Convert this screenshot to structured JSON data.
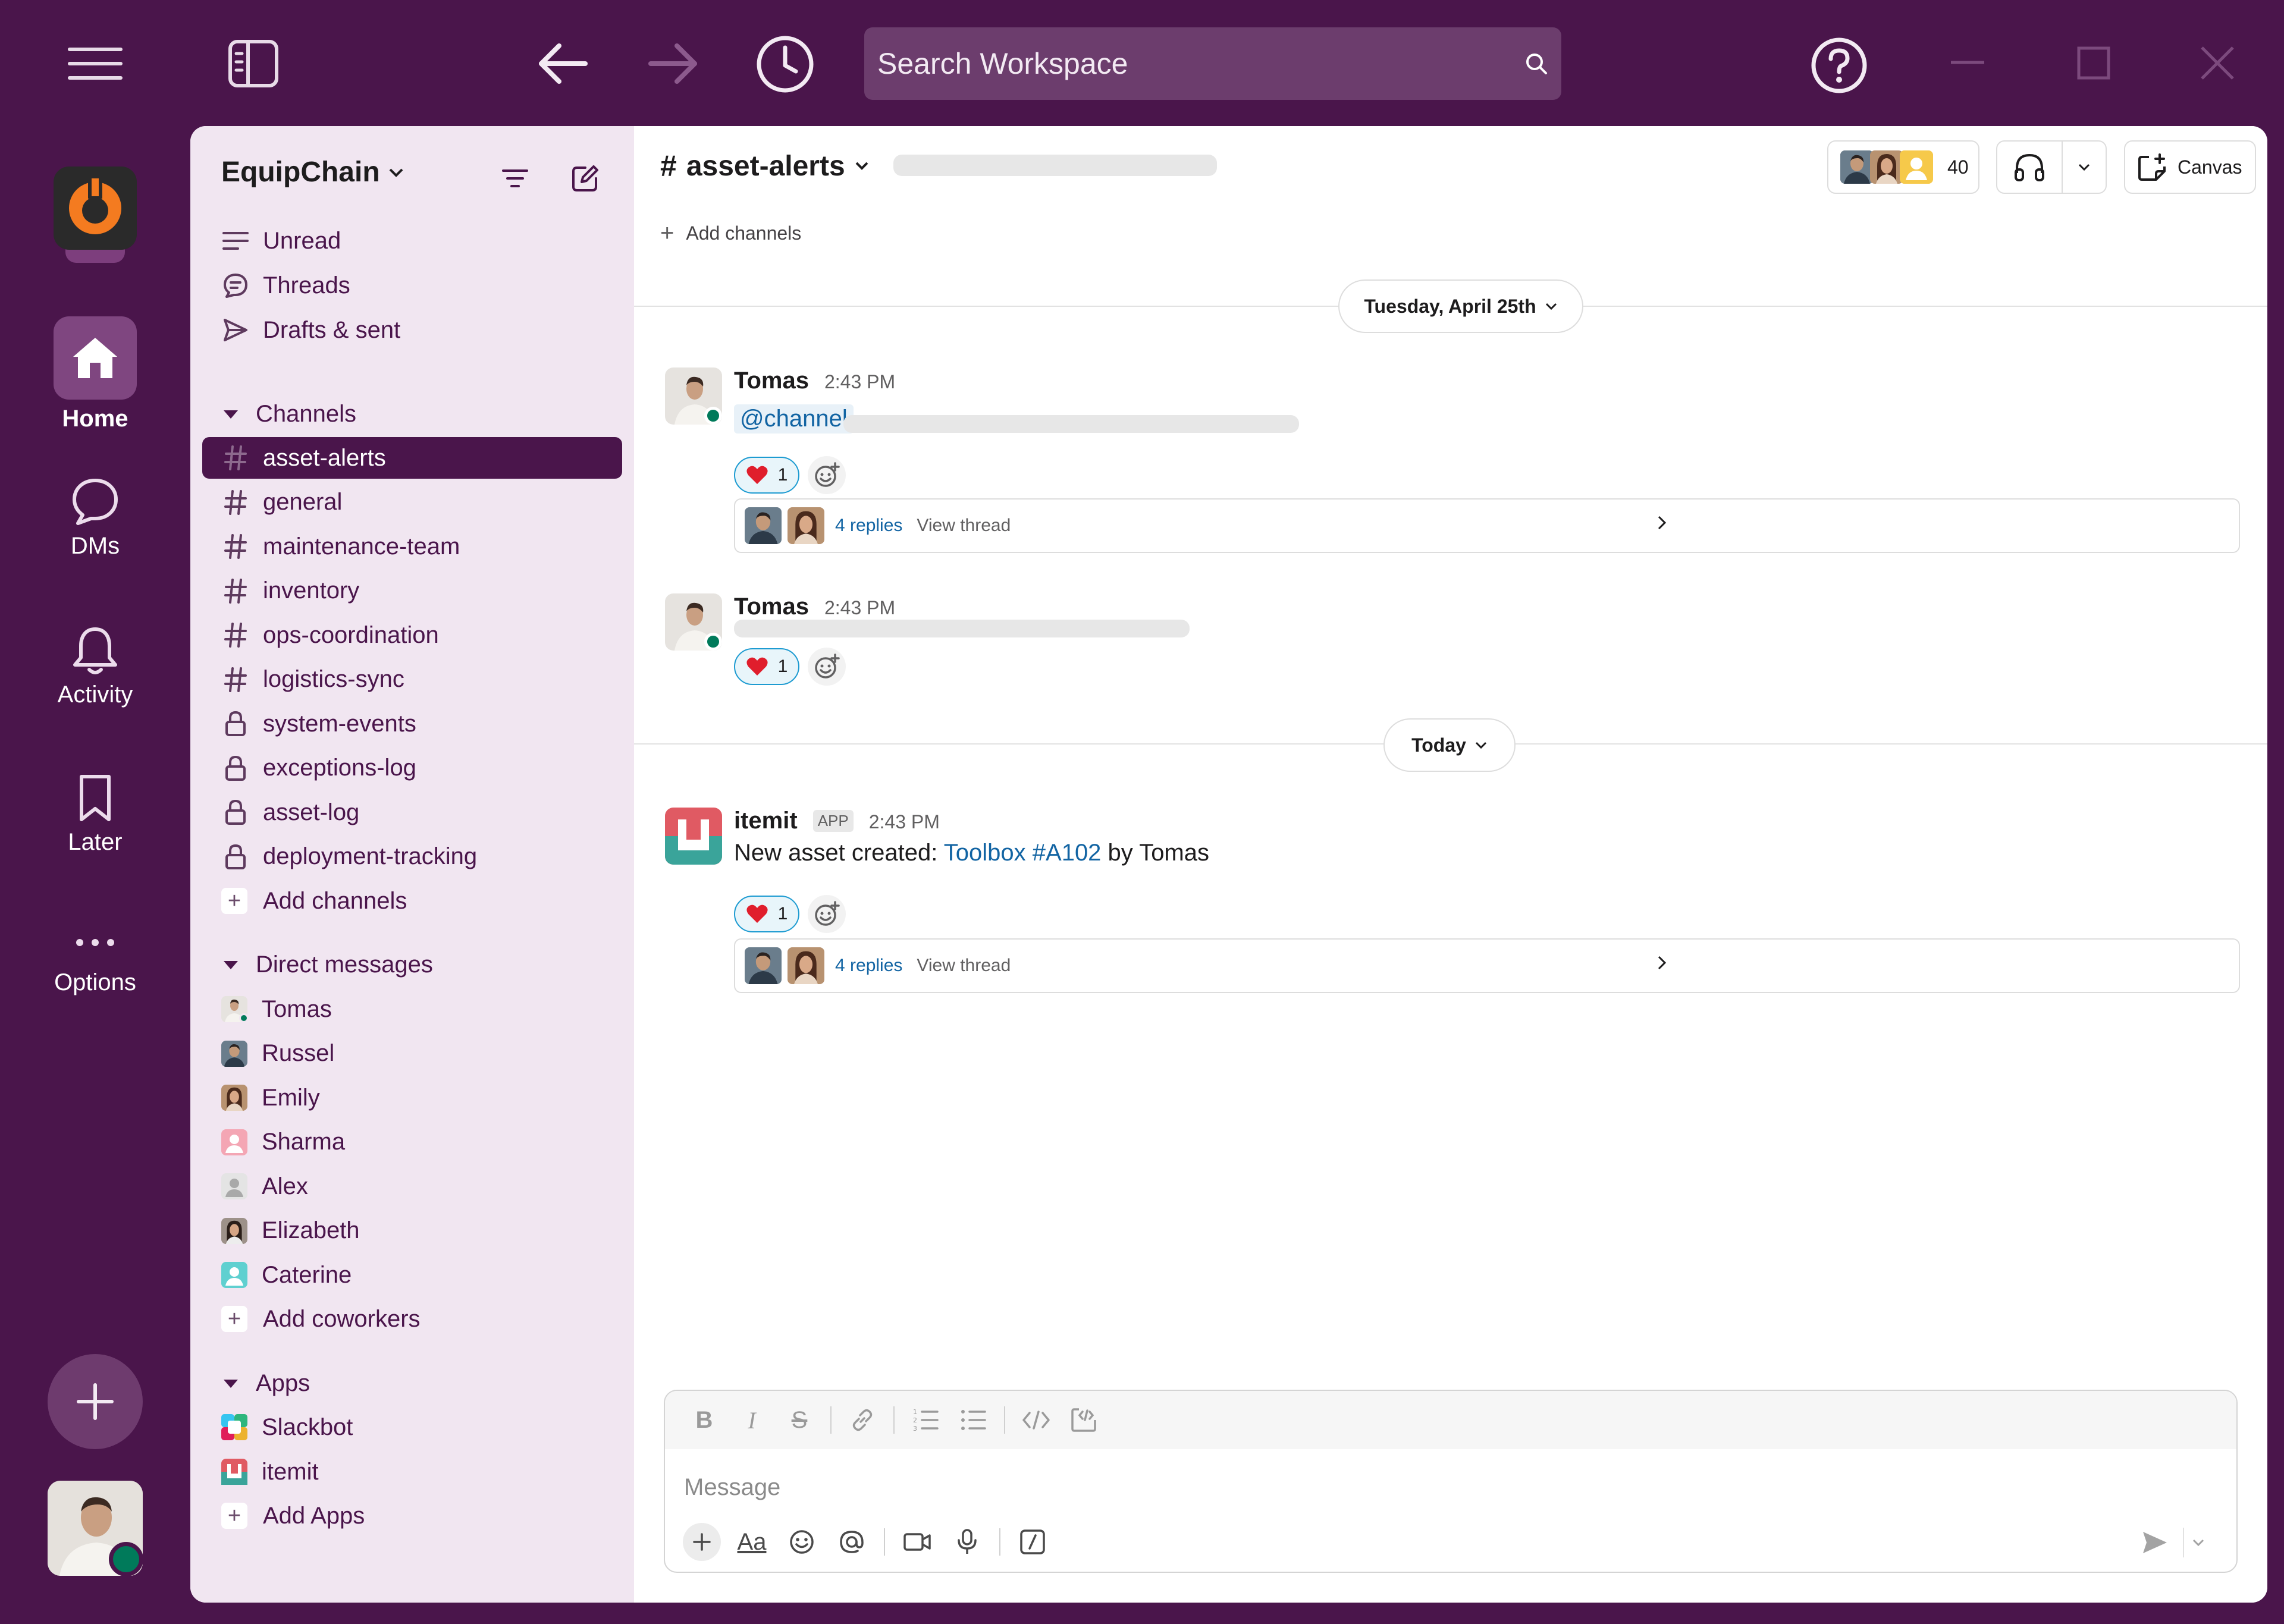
{
  "search": {
    "placeholder": "Search Workspace"
  },
  "rail": {
    "home": "Home",
    "dms": "DMs",
    "activity": "Activity",
    "later": "Later",
    "options": "Options"
  },
  "workspace": {
    "name": "EquipChain"
  },
  "sidebar": {
    "nav": [
      "Unread",
      "Threads",
      "Drafts & sent"
    ],
    "channels_header": "Channels",
    "channels": [
      {
        "name": "asset-alerts",
        "private": false,
        "active": true
      },
      {
        "name": "general",
        "private": false
      },
      {
        "name": "maintenance-team",
        "private": false
      },
      {
        "name": "inventory",
        "private": false
      },
      {
        "name": "ops-coordination",
        "private": false
      },
      {
        "name": "logistics-sync",
        "private": false
      },
      {
        "name": "system-events",
        "private": true
      },
      {
        "name": "exceptions-log",
        "private": true
      },
      {
        "name": "asset-log",
        "private": true
      },
      {
        "name": "deployment-tracking",
        "private": true
      }
    ],
    "add_channels": "Add channels",
    "dm_header": "Direct messages",
    "dms": [
      "Tomas",
      "Russel",
      "Emily",
      "Sharma",
      "Alex",
      "Elizabeth",
      "Caterine"
    ],
    "add_coworkers": "Add coworkers",
    "apps_header": "Apps",
    "apps": [
      "Slackbot",
      "itemit"
    ],
    "add_apps": "Add Apps"
  },
  "channel": {
    "name": "asset-alerts",
    "member_count": "40",
    "canvas_label": "Canvas",
    "add_channels": "Add channels"
  },
  "dates": {
    "first": "Tuesday, April 25th",
    "second": "Today"
  },
  "messages": [
    {
      "author": "Tomas",
      "time": "2:43 PM",
      "mention": "@channel",
      "reaction_count": "1",
      "replies": "4 replies",
      "view_thread": "View thread"
    },
    {
      "author": "Tomas",
      "time": "2:43 PM",
      "reaction_count": "1"
    },
    {
      "author": "itemit",
      "badge": "APP",
      "time": "2:43 PM",
      "text_before": "New asset created: ",
      "link": "Toolbox #A102",
      "text_after": " by Tomas",
      "reaction_count": "1",
      "replies": "4 replies",
      "view_thread": "View thread"
    }
  ],
  "composer": {
    "placeholder": "Message"
  },
  "colors": {
    "aubergine": "#4a154b",
    "sidebar_bg": "#f1e6f1",
    "link": "#1264a3",
    "online": "#007a5a",
    "reaction_border": "#1d9bd1"
  }
}
